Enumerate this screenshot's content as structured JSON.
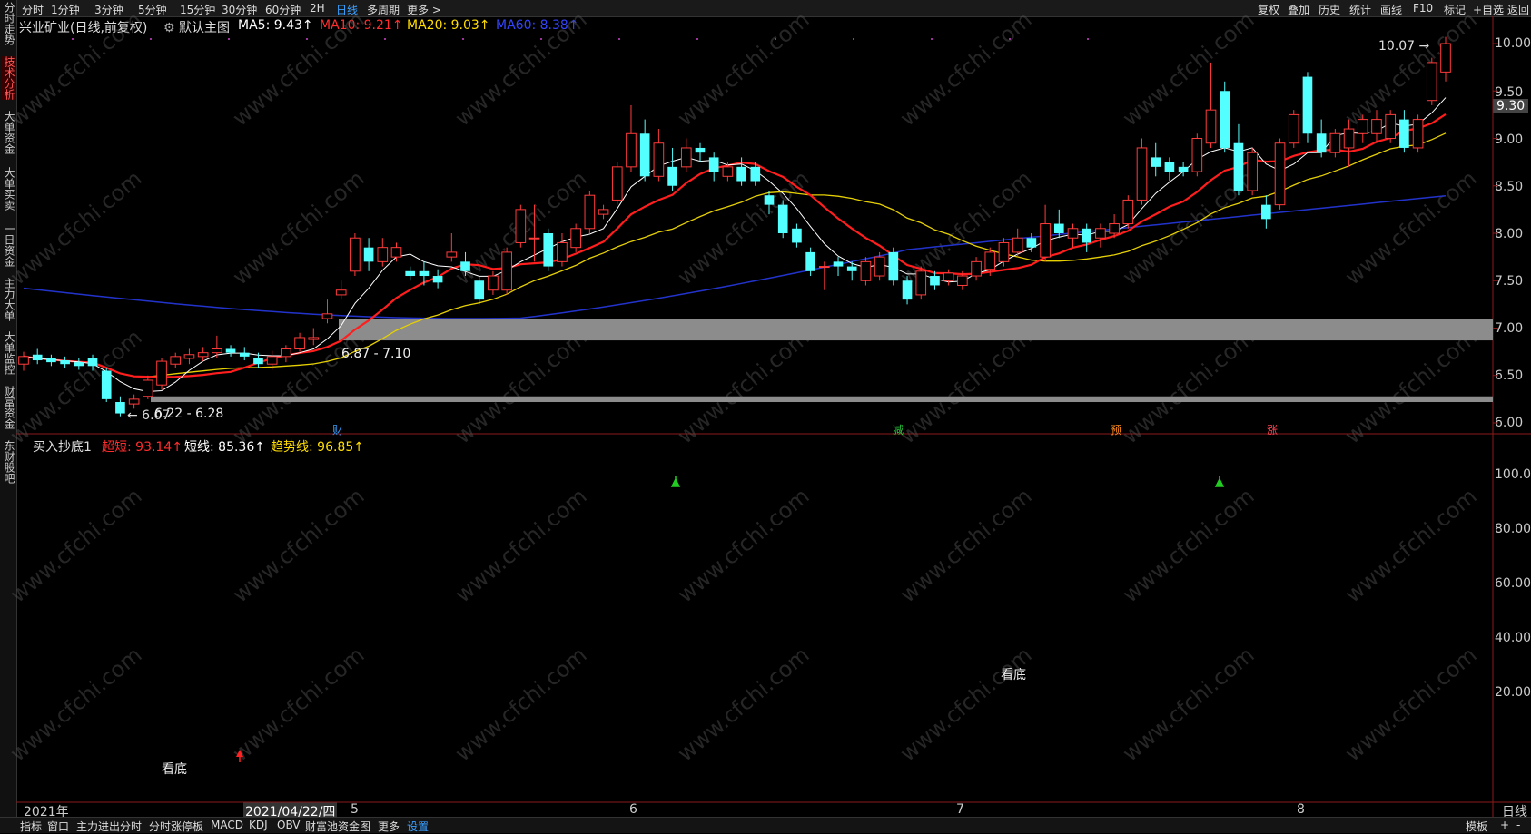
{
  "toolbar": {
    "periods": [
      "分时",
      "1分钟",
      "3分钟",
      "5分钟",
      "15分钟",
      "30分钟",
      "60分钟",
      "2H",
      "日线",
      "多周期",
      "更多 >"
    ],
    "active_period": "日线",
    "right": [
      "复权",
      "叠加",
      "历史",
      "统计",
      "画线",
      "F10",
      "标记",
      "+自选",
      "返回"
    ]
  },
  "sidebar": {
    "items": [
      "分时走势",
      "技术分析",
      "大单资金",
      "大单买卖",
      "一日资金",
      "主力大单",
      "大单监控",
      "财富资金",
      "东财股吧"
    ],
    "active": "技术分析"
  },
  "main": {
    "stock": "兴业矿业(日线,前复权)",
    "chart_name": "默认主图",
    "ma5": "MA5: 9.43↑",
    "ma10": "MA10: 9.21↑",
    "ma20": "MA20: 9.03↑",
    "ma60": "MA60: 8.38↑",
    "price_ticks": [
      "10.00",
      "9.50",
      "9.00",
      "8.50",
      "8.00",
      "7.50",
      "7.00",
      "6.50",
      "6.00"
    ],
    "current_price": "9.30",
    "high_label": "10.07",
    "low_label": "6.07",
    "zone1": "6.87 - 7.10",
    "zone2": "6.22 - 6.28",
    "events": [
      "财",
      "减",
      "预",
      "涨"
    ]
  },
  "indicator": {
    "name": "买入抄底1",
    "line1": "超短: 93.14↑",
    "line2": "短线: 85.36↑",
    "line3": "趋势线: 96.85↑",
    "ticks": [
      "100.00",
      "80.00",
      "60.00",
      "40.00",
      "20.00"
    ],
    "bottom_label1": "看底",
    "bottom_label2": "看底"
  },
  "xaxis": {
    "labels": [
      "2021年",
      "2021/04/22/四",
      "5",
      "6",
      "7",
      "8"
    ],
    "period": "日线"
  },
  "bottombar": {
    "items": [
      "指标",
      "窗口",
      "主力进出分时",
      "分时涨停板",
      "MACD",
      "KDJ",
      "OBV",
      "财富池资金图",
      "更多",
      "设置"
    ],
    "right": [
      "模板",
      "+",
      "-"
    ]
  },
  "watermark": "www.cfchi.com",
  "chart_data": {
    "type": "candlestick",
    "price_range": [
      6.0,
      10.1
    ],
    "indicator_range": [
      0,
      105
    ],
    "candles": [
      {
        "o": 6.62,
        "c": 6.7,
        "h": 6.75,
        "l": 6.55
      },
      {
        "o": 6.72,
        "c": 6.66,
        "h": 6.78,
        "l": 6.62
      },
      {
        "o": 6.68,
        "c": 6.64,
        "h": 6.72,
        "l": 6.6
      },
      {
        "o": 6.66,
        "c": 6.62,
        "h": 6.7,
        "l": 6.58
      },
      {
        "o": 6.64,
        "c": 6.6,
        "h": 6.68,
        "l": 6.56
      },
      {
        "o": 6.68,
        "c": 6.6,
        "h": 6.72,
        "l": 6.55
      },
      {
        "o": 6.55,
        "c": 6.25,
        "h": 6.58,
        "l": 6.22
      },
      {
        "o": 6.22,
        "c": 6.1,
        "h": 6.28,
        "l": 6.07
      },
      {
        "o": 6.2,
        "c": 6.25,
        "h": 6.3,
        "l": 6.15
      },
      {
        "o": 6.28,
        "c": 6.45,
        "h": 6.5,
        "l": 6.25
      },
      {
        "o": 6.4,
        "c": 6.65,
        "h": 6.68,
        "l": 6.35
      },
      {
        "o": 6.62,
        "c": 6.7,
        "h": 6.74,
        "l": 6.58
      },
      {
        "o": 6.68,
        "c": 6.72,
        "h": 6.78,
        "l": 6.62
      },
      {
        "o": 6.7,
        "c": 6.74,
        "h": 6.8,
        "l": 6.65
      },
      {
        "o": 6.74,
        "c": 6.78,
        "h": 6.92,
        "l": 6.68
      },
      {
        "o": 6.78,
        "c": 6.74,
        "h": 6.82,
        "l": 6.7
      },
      {
        "o": 6.74,
        "c": 6.7,
        "h": 6.8,
        "l": 6.66
      },
      {
        "o": 6.68,
        "c": 6.62,
        "h": 6.74,
        "l": 6.58
      },
      {
        "o": 6.62,
        "c": 6.7,
        "h": 6.76,
        "l": 6.56
      },
      {
        "o": 6.7,
        "c": 6.78,
        "h": 6.82,
        "l": 6.64
      },
      {
        "o": 6.78,
        "c": 6.9,
        "h": 6.95,
        "l": 6.75
      },
      {
        "o": 6.88,
        "c": 6.9,
        "h": 7.0,
        "l": 6.82
      },
      {
        "o": 7.1,
        "c": 7.15,
        "h": 7.3,
        "l": 7.05
      },
      {
        "o": 7.35,
        "c": 7.4,
        "h": 7.5,
        "l": 7.3
      },
      {
        "o": 7.6,
        "c": 7.95,
        "h": 8.0,
        "l": 7.55
      },
      {
        "o": 7.85,
        "c": 7.7,
        "h": 7.95,
        "l": 7.6
      },
      {
        "o": 7.7,
        "c": 7.85,
        "h": 7.95,
        "l": 7.65
      },
      {
        "o": 7.75,
        "c": 7.85,
        "h": 7.9,
        "l": 7.7
      },
      {
        "o": 7.6,
        "c": 7.55,
        "h": 7.65,
        "l": 7.5
      },
      {
        "o": 7.6,
        "c": 7.55,
        "h": 7.7,
        "l": 7.45
      },
      {
        "o": 7.55,
        "c": 7.48,
        "h": 7.62,
        "l": 7.42
      },
      {
        "o": 7.75,
        "c": 7.8,
        "h": 8.0,
        "l": 7.7
      },
      {
        "o": 7.7,
        "c": 7.6,
        "h": 7.8,
        "l": 7.55
      },
      {
        "o": 7.5,
        "c": 7.3,
        "h": 7.55,
        "l": 7.25
      },
      {
        "o": 7.4,
        "c": 7.55,
        "h": 7.6,
        "l": 7.35
      },
      {
        "o": 7.4,
        "c": 7.8,
        "h": 7.85,
        "l": 7.35
      },
      {
        "o": 7.9,
        "c": 8.25,
        "h": 8.3,
        "l": 7.85
      },
      {
        "o": 7.95,
        "c": 7.95,
        "h": 8.3,
        "l": 7.7
      },
      {
        "o": 8.0,
        "c": 7.65,
        "h": 8.05,
        "l": 7.6
      },
      {
        "o": 7.7,
        "c": 7.9,
        "h": 8.0,
        "l": 7.65
      },
      {
        "o": 7.85,
        "c": 8.05,
        "h": 8.1,
        "l": 7.8
      },
      {
        "o": 8.05,
        "c": 8.4,
        "h": 8.45,
        "l": 8.0
      },
      {
        "o": 8.2,
        "c": 8.25,
        "h": 8.3,
        "l": 8.15
      },
      {
        "o": 8.35,
        "c": 8.7,
        "h": 8.75,
        "l": 8.3
      },
      {
        "o": 8.7,
        "c": 9.05,
        "h": 9.35,
        "l": 8.65
      },
      {
        "o": 9.05,
        "c": 8.6,
        "h": 9.2,
        "l": 8.55
      },
      {
        "o": 8.6,
        "c": 8.95,
        "h": 9.1,
        "l": 8.55
      },
      {
        "o": 8.7,
        "c": 8.5,
        "h": 8.9,
        "l": 8.45
      },
      {
        "o": 8.7,
        "c": 8.9,
        "h": 9.0,
        "l": 8.65
      },
      {
        "o": 8.9,
        "c": 8.85,
        "h": 8.95,
        "l": 8.75
      },
      {
        "o": 8.8,
        "c": 8.65,
        "h": 8.85,
        "l": 8.55
      },
      {
        "o": 8.6,
        "c": 8.7,
        "h": 8.75,
        "l": 8.55
      },
      {
        "o": 8.7,
        "c": 8.55,
        "h": 8.8,
        "l": 8.5
      },
      {
        "o": 8.7,
        "c": 8.55,
        "h": 8.75,
        "l": 8.5
      },
      {
        "o": 8.4,
        "c": 8.3,
        "h": 8.45,
        "l": 8.2
      },
      {
        "o": 8.3,
        "c": 8.0,
        "h": 8.35,
        "l": 7.95
      },
      {
        "o": 8.05,
        "c": 7.9,
        "h": 8.1,
        "l": 7.85
      },
      {
        "o": 7.8,
        "c": 7.6,
        "h": 7.85,
        "l": 7.55
      },
      {
        "o": 7.65,
        "c": 7.65,
        "h": 7.7,
        "l": 7.4
      },
      {
        "o": 7.7,
        "c": 7.65,
        "h": 7.75,
        "l": 7.55
      },
      {
        "o": 7.65,
        "c": 7.6,
        "h": 7.7,
        "l": 7.5
      },
      {
        "o": 7.5,
        "c": 7.7,
        "h": 7.75,
        "l": 7.45
      },
      {
        "o": 7.55,
        "c": 7.75,
        "h": 7.8,
        "l": 7.5
      },
      {
        "o": 7.8,
        "c": 7.5,
        "h": 7.85,
        "l": 7.45
      },
      {
        "o": 7.5,
        "c": 7.3,
        "h": 7.55,
        "l": 7.25
      },
      {
        "o": 7.35,
        "c": 7.6,
        "h": 7.65,
        "l": 7.3
      },
      {
        "o": 7.55,
        "c": 7.45,
        "h": 7.6,
        "l": 7.4
      },
      {
        "o": 7.5,
        "c": 7.58,
        "h": 7.62,
        "l": 7.45
      },
      {
        "o": 7.45,
        "c": 7.55,
        "h": 7.6,
        "l": 7.4
      },
      {
        "o": 7.55,
        "c": 7.7,
        "h": 7.75,
        "l": 7.5
      },
      {
        "o": 7.62,
        "c": 7.8,
        "h": 7.85,
        "l": 7.55
      },
      {
        "o": 7.7,
        "c": 7.9,
        "h": 7.95,
        "l": 7.65
      },
      {
        "o": 7.8,
        "c": 7.95,
        "h": 8.05,
        "l": 7.75
      },
      {
        "o": 7.95,
        "c": 7.85,
        "h": 8.0,
        "l": 7.8
      },
      {
        "o": 7.75,
        "c": 8.1,
        "h": 8.3,
        "l": 7.7
      },
      {
        "o": 8.1,
        "c": 8.0,
        "h": 8.25,
        "l": 7.95
      },
      {
        "o": 7.95,
        "c": 8.05,
        "h": 8.1,
        "l": 7.85
      },
      {
        "o": 8.05,
        "c": 7.9,
        "h": 8.1,
        "l": 7.8
      },
      {
        "o": 7.95,
        "c": 8.05,
        "h": 8.1,
        "l": 7.85
      },
      {
        "o": 8.0,
        "c": 8.1,
        "h": 8.2,
        "l": 7.95
      },
      {
        "o": 8.1,
        "c": 8.35,
        "h": 8.4,
        "l": 8.05
      },
      {
        "o": 8.35,
        "c": 8.9,
        "h": 9.0,
        "l": 8.3
      },
      {
        "o": 8.8,
        "c": 8.7,
        "h": 8.95,
        "l": 8.6
      },
      {
        "o": 8.75,
        "c": 8.65,
        "h": 8.8,
        "l": 8.55
      },
      {
        "o": 8.7,
        "c": 8.65,
        "h": 8.75,
        "l": 8.6
      },
      {
        "o": 8.65,
        "c": 9.0,
        "h": 9.05,
        "l": 8.6
      },
      {
        "o": 8.95,
        "c": 9.3,
        "h": 9.8,
        "l": 8.9
      },
      {
        "o": 9.5,
        "c": 8.9,
        "h": 9.6,
        "l": 8.85
      },
      {
        "o": 8.95,
        "c": 8.45,
        "h": 9.15,
        "l": 8.4
      },
      {
        "o": 8.45,
        "c": 8.85,
        "h": 8.9,
        "l": 8.4
      },
      {
        "o": 8.3,
        "c": 8.15,
        "h": 8.4,
        "l": 8.05
      },
      {
        "o": 8.3,
        "c": 8.95,
        "h": 9.0,
        "l": 8.25
      },
      {
        "o": 8.95,
        "c": 9.25,
        "h": 9.3,
        "l": 8.9
      },
      {
        "o": 9.65,
        "c": 9.05,
        "h": 9.7,
        "l": 8.95
      },
      {
        "o": 9.05,
        "c": 8.85,
        "h": 9.2,
        "l": 8.8
      },
      {
        "o": 8.85,
        "c": 9.05,
        "h": 9.1,
        "l": 8.8
      },
      {
        "o": 8.9,
        "c": 9.1,
        "h": 9.2,
        "l": 8.7
      },
      {
        "o": 9.05,
        "c": 9.2,
        "h": 9.25,
        "l": 8.95
      },
      {
        "o": 9.05,
        "c": 9.2,
        "h": 9.3,
        "l": 8.95
      },
      {
        "o": 9.0,
        "c": 9.25,
        "h": 9.3,
        "l": 8.95
      },
      {
        "o": 9.2,
        "c": 8.9,
        "h": 9.3,
        "l": 8.85
      },
      {
        "o": 8.9,
        "c": 9.2,
        "h": 9.25,
        "l": 8.85
      },
      {
        "o": 9.4,
        "c": 9.8,
        "h": 9.85,
        "l": 9.35
      },
      {
        "o": 9.7,
        "c": 10.0,
        "h": 10.07,
        "l": 9.6
      }
    ]
  }
}
